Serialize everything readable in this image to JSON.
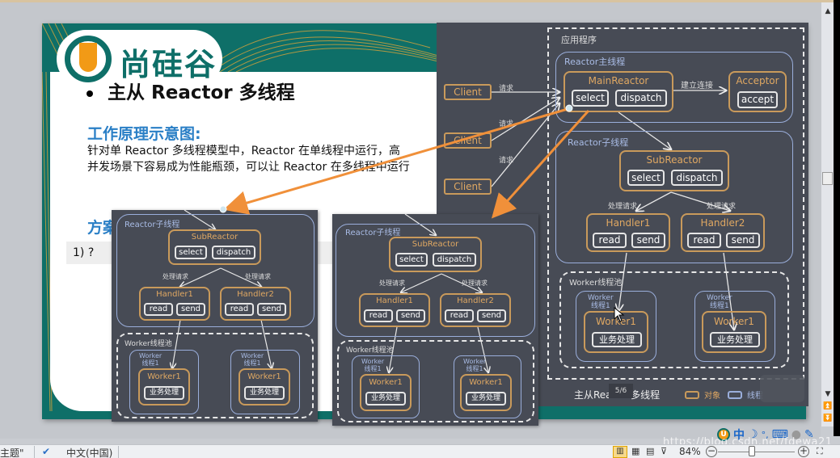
{
  "slide": {
    "logo_text": "尚硅谷",
    "bullet_title": "主从 Reactor 多线程",
    "section_heading": "工作原理示意图:",
    "paragraph": "针对单 Reactor 多线程模型中，Reactor 在单线程中运行，高并发场景下容易成为性能瓶颈，可以让 Reactor 在多线程中运行",
    "section_heading_2": "方案",
    "list_item": "1)   ?"
  },
  "big_diagram": {
    "app_label": "应用程序",
    "main_thread_label": "Reactor主线程",
    "main_reactor": {
      "title": "MainReactor",
      "ops": [
        "select",
        "dispatch"
      ]
    },
    "connect_label": "建立连接",
    "acceptor": {
      "title": "Acceptor",
      "ops": [
        "accept"
      ]
    },
    "clients": [
      "Client",
      "Client",
      "Client"
    ],
    "request_label": "请求",
    "sub_thread_label": "Reactor子线程",
    "sub_reactor": {
      "title": "SubReactor",
      "ops": [
        "select",
        "dispatch"
      ]
    },
    "handle_label": "处理请求",
    "handlers": [
      {
        "title": "Handler1",
        "ops": [
          "read",
          "send"
        ]
      },
      {
        "title": "Handler2",
        "ops": [
          "read",
          "send"
        ]
      }
    ],
    "worker_pool_label": "Worker线程池",
    "worker_threads": [
      {
        "thread_label": "Worker\n线程1",
        "title": "Worker1",
        "task": "业务处理"
      },
      {
        "thread_label": "Worker\n线程1",
        "title": "Worker1",
        "task": "业务处理"
      }
    ],
    "caption": "主从Reactor多线程",
    "page_overlay": "5/6",
    "legend": [
      {
        "label": "对象",
        "color": "#c99a5b"
      },
      {
        "label": "线程",
        "color": "#9aaedb"
      }
    ]
  },
  "sub_diagram": {
    "sub_thread_label": "Reactor子线程",
    "sub_reactor": {
      "title": "SubReactor",
      "ops": [
        "select",
        "dispatch"
      ]
    },
    "handle_label": "处理请求",
    "handlers": [
      {
        "title": "Handler1",
        "ops": [
          "read",
          "send"
        ]
      },
      {
        "title": "Handler2",
        "ops": [
          "read",
          "send"
        ]
      }
    ],
    "worker_pool_label": "Worker线程池",
    "worker_threads": [
      {
        "thread_label": "Worker\n线程1",
        "title": "Worker1",
        "task": "业务处理"
      },
      {
        "thread_label": "Worker\n线程1",
        "title": "Worker1",
        "task": "业务处理"
      }
    ]
  },
  "statusbar": {
    "theme": "主题\"",
    "language": "中文(中国)",
    "zoom": "84%",
    "zoom_out": "−",
    "zoom_in": "+"
  },
  "ime": {
    "logo": "U",
    "mode": "中",
    "moon": "☽",
    "punct": "°,",
    "keyboard": "⌨",
    "user": "●",
    "tool": "✎"
  },
  "watermark": "https://blog.csdn.net/fdewa21",
  "colors": {
    "slide_teal": "#0e6f68",
    "logo_orange": "#f29a16",
    "heading_blue": "#2a7fc6",
    "panel_bg": "#474b55",
    "object_border": "#c99a5b",
    "thread_border": "#9aaedb",
    "arrow_orange": "#f0903a"
  }
}
